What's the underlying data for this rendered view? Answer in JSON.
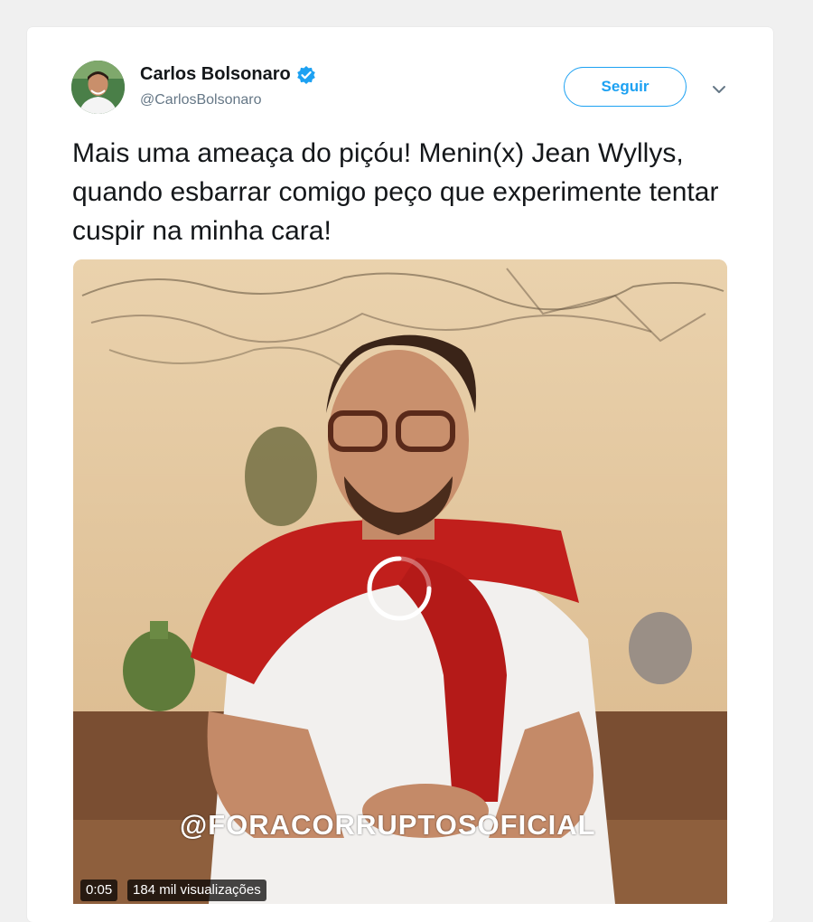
{
  "tweet": {
    "author_name": "Carlos Bolsonaro",
    "author_handle": "@CarlosBolsonaro",
    "verified_icon": "verified-badge-icon",
    "follow_label": "Seguir",
    "menu_icon": "chevron-down-icon",
    "text": "Mais uma ameaça do piçóu! Menin(x) Jean Wyllys, quando esbarrar comigo peço que experimente tentar cuspir na minha cara!"
  },
  "video": {
    "watermark": "@FORACORRUPTOSOFICIAL",
    "elapsed": "0:05",
    "views": "184 mil visualizações",
    "loading_icon": "loading-spinner-icon"
  },
  "colors": {
    "accent": "#1da1f2",
    "text": "#14171a",
    "muted": "#657786",
    "background": "#f0f0f0"
  }
}
